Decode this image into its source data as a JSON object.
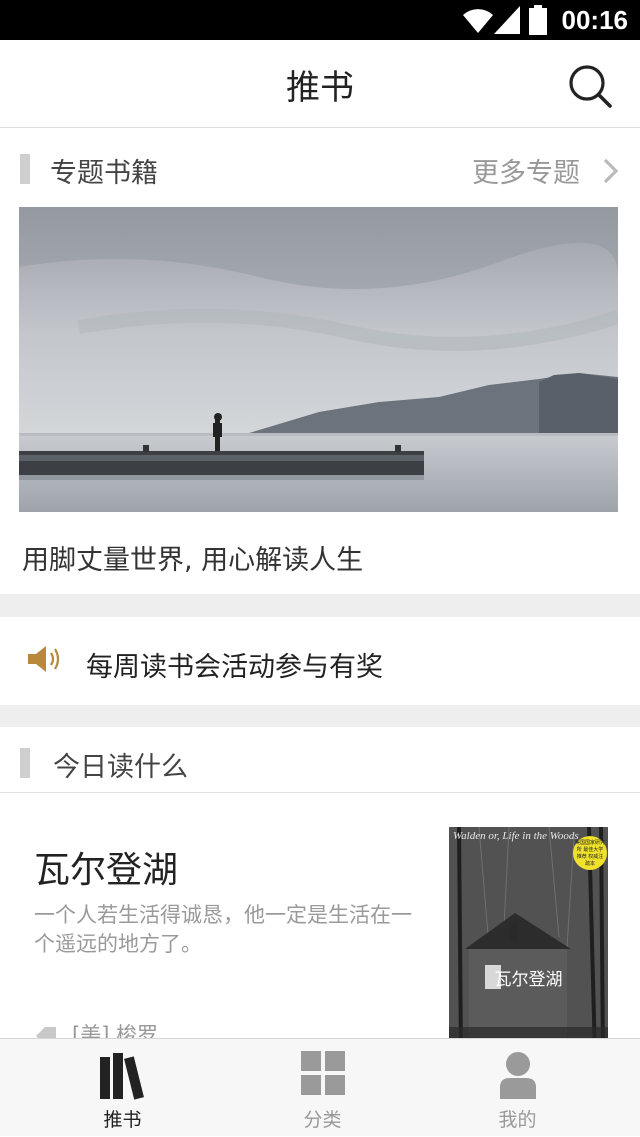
{
  "status_bar": {
    "time": "00:16"
  },
  "header": {
    "title": "推书",
    "search_icon": "search-icon"
  },
  "topics": {
    "label": "专题书籍",
    "more_label": "更多专题",
    "caption": "用脚丈量世界, 用心解读人生"
  },
  "notice": {
    "text": "每周读书会活动参与有奖"
  },
  "today": {
    "label": "今日读什么",
    "book": {
      "title": "瓦尔登湖",
      "description": "一个人若生活得诚恳，他一定是生活在一个遥远的地方了。",
      "author": "[美]  梭罗",
      "cover_title_cn": "瓦尔登湖",
      "cover_title_en": "Walden or, Life in the Woods",
      "cover_badge": "美国国家研究所 最佳大学推荐 权威注疏本"
    }
  },
  "tabs": [
    {
      "label": "推书",
      "icon": "books-icon",
      "active": true
    },
    {
      "label": "分类",
      "icon": "grid-icon",
      "active": false
    },
    {
      "label": "我的",
      "icon": "user-icon",
      "active": false
    }
  ],
  "colors": {
    "speaker": "#b8893a",
    "gap": "#eeeeee",
    "accent_bar": "#cfcfcf"
  }
}
